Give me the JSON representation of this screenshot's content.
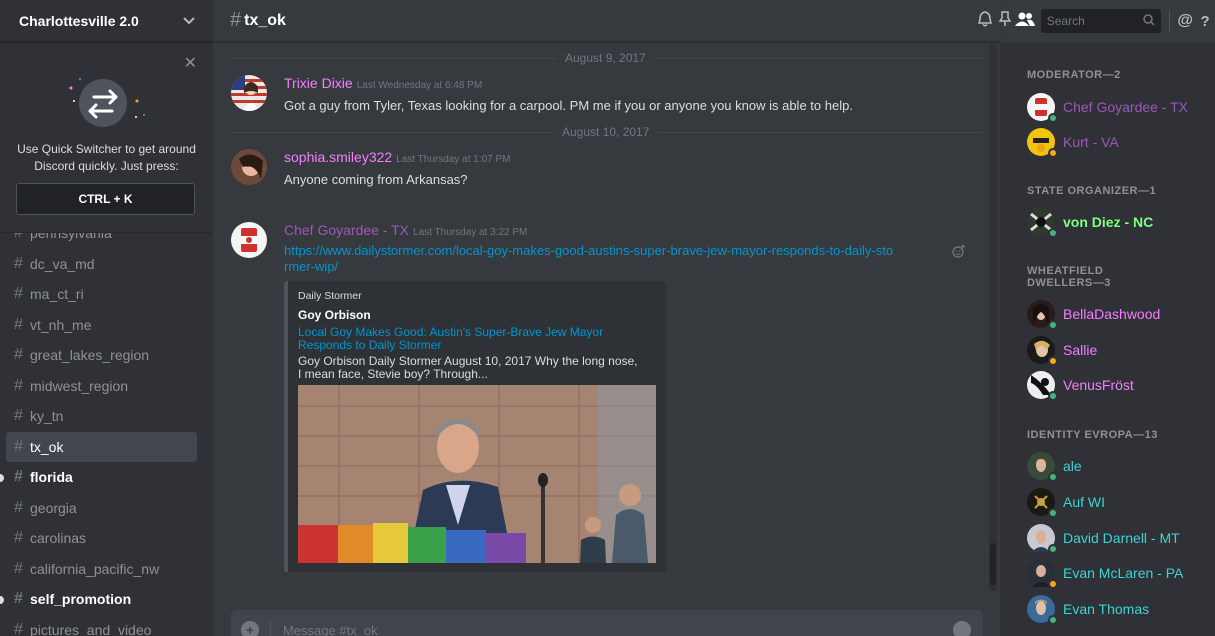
{
  "server": {
    "name": "Charlottesville 2.0"
  },
  "quick_switcher": {
    "text": "Use Quick Switcher to get around Discord quickly. Just press:",
    "shortcut": "CTRL + K"
  },
  "channels": [
    {
      "name": "pennsylvania",
      "state": "partial"
    },
    {
      "name": "dc_va_md",
      "state": "normal"
    },
    {
      "name": "ma_ct_ri",
      "state": "normal"
    },
    {
      "name": "vt_nh_me",
      "state": "normal"
    },
    {
      "name": "great_lakes_region",
      "state": "normal"
    },
    {
      "name": "midwest_region",
      "state": "normal"
    },
    {
      "name": "ky_tn",
      "state": "normal"
    },
    {
      "name": "tx_ok",
      "state": "active"
    },
    {
      "name": "florida",
      "state": "unread"
    },
    {
      "name": "georgia",
      "state": "normal"
    },
    {
      "name": "carolinas",
      "state": "normal"
    },
    {
      "name": "california_pacific_nw",
      "state": "normal"
    },
    {
      "name": "self_promotion",
      "state": "unread"
    },
    {
      "name": "pictures_and_video",
      "state": "partial"
    }
  ],
  "channel": {
    "hash": "#",
    "name": "tx_ok"
  },
  "toolbar": {
    "search_placeholder": "Search",
    "mention_label": "@",
    "help_label": "?"
  },
  "dividers": {
    "d1": "August 9, 2017",
    "d2": "August 10, 2017"
  },
  "messages": {
    "m1": {
      "author": "Trixie Dixie",
      "author_color": "#f47fff",
      "time": "Last Wednesday at 6:48 PM",
      "text": "Got a guy from Tyler, Texas looking for a carpool. PM me if you or anyone you know is able to help."
    },
    "m2": {
      "author": "sophia.smiley322",
      "author_color": "#f47fff",
      "time": "Last Thursday at 1:07 PM",
      "text": "Anyone coming from Arkansas?"
    },
    "m3": {
      "author": "Chef Goyardee - TX",
      "author_color": "#9b59b6",
      "time": "Last Thursday at 3:22 PM",
      "link": "https://www.dailystormer.com/local-goy-makes-good-austins-super-brave-jew-mayor-responds-to-daily-stormer-wip/"
    }
  },
  "embed": {
    "provider": "Daily Stormer",
    "author": "Goy Orbison",
    "title": "Local Goy Makes Good: Austin's Super-Brave Jew Mayor Responds to Daily Stormer",
    "description": "Goy Orbison Daily Stormer August 10, 2017 Why the long nose, I mean face, Stevie boy? Through..."
  },
  "composer": {
    "placeholder": "Message #tx_ok"
  },
  "members": {
    "roles": {
      "r1": "MODERATOR—2",
      "r2": "STATE ORGANIZER—1",
      "r3": "WHEATFIELD DWELLERS—3",
      "r4": "IDENTITY EVROPA—13"
    },
    "list": {
      "u1": {
        "name": "Chef Goyardee - TX",
        "color": "#9b59b6",
        "status": "online"
      },
      "u2": {
        "name": "Kurt - VA",
        "color": "#9b59b6",
        "status": "idle"
      },
      "u3": {
        "name": "von Diez - NC",
        "color": "#7fff7f",
        "status": "online"
      },
      "u4": {
        "name": "BellaDashwood",
        "color": "#f47fff",
        "status": "online"
      },
      "u5": {
        "name": "Sallie",
        "color": "#f47fff",
        "status": "idle"
      },
      "u6": {
        "name": "VenusFröst",
        "color": "#f47fff",
        "status": "online"
      },
      "u7": {
        "name": "ale",
        "color": "#3ad4d4",
        "status": "online"
      },
      "u8": {
        "name": "Auf WI",
        "color": "#3ad4d4",
        "status": "online"
      },
      "u9": {
        "name": "David Darnell - MT",
        "color": "#3ad4d4",
        "status": "online"
      },
      "u10": {
        "name": "Evan McLaren - PA",
        "color": "#3ad4d4",
        "status": "idle"
      },
      "u11": {
        "name": "Evan Thomas",
        "color": "#3ad4d4",
        "status": "online"
      }
    }
  },
  "colors": {
    "online": "#43b581",
    "idle": "#faa61a",
    "link": "#0096cf"
  }
}
